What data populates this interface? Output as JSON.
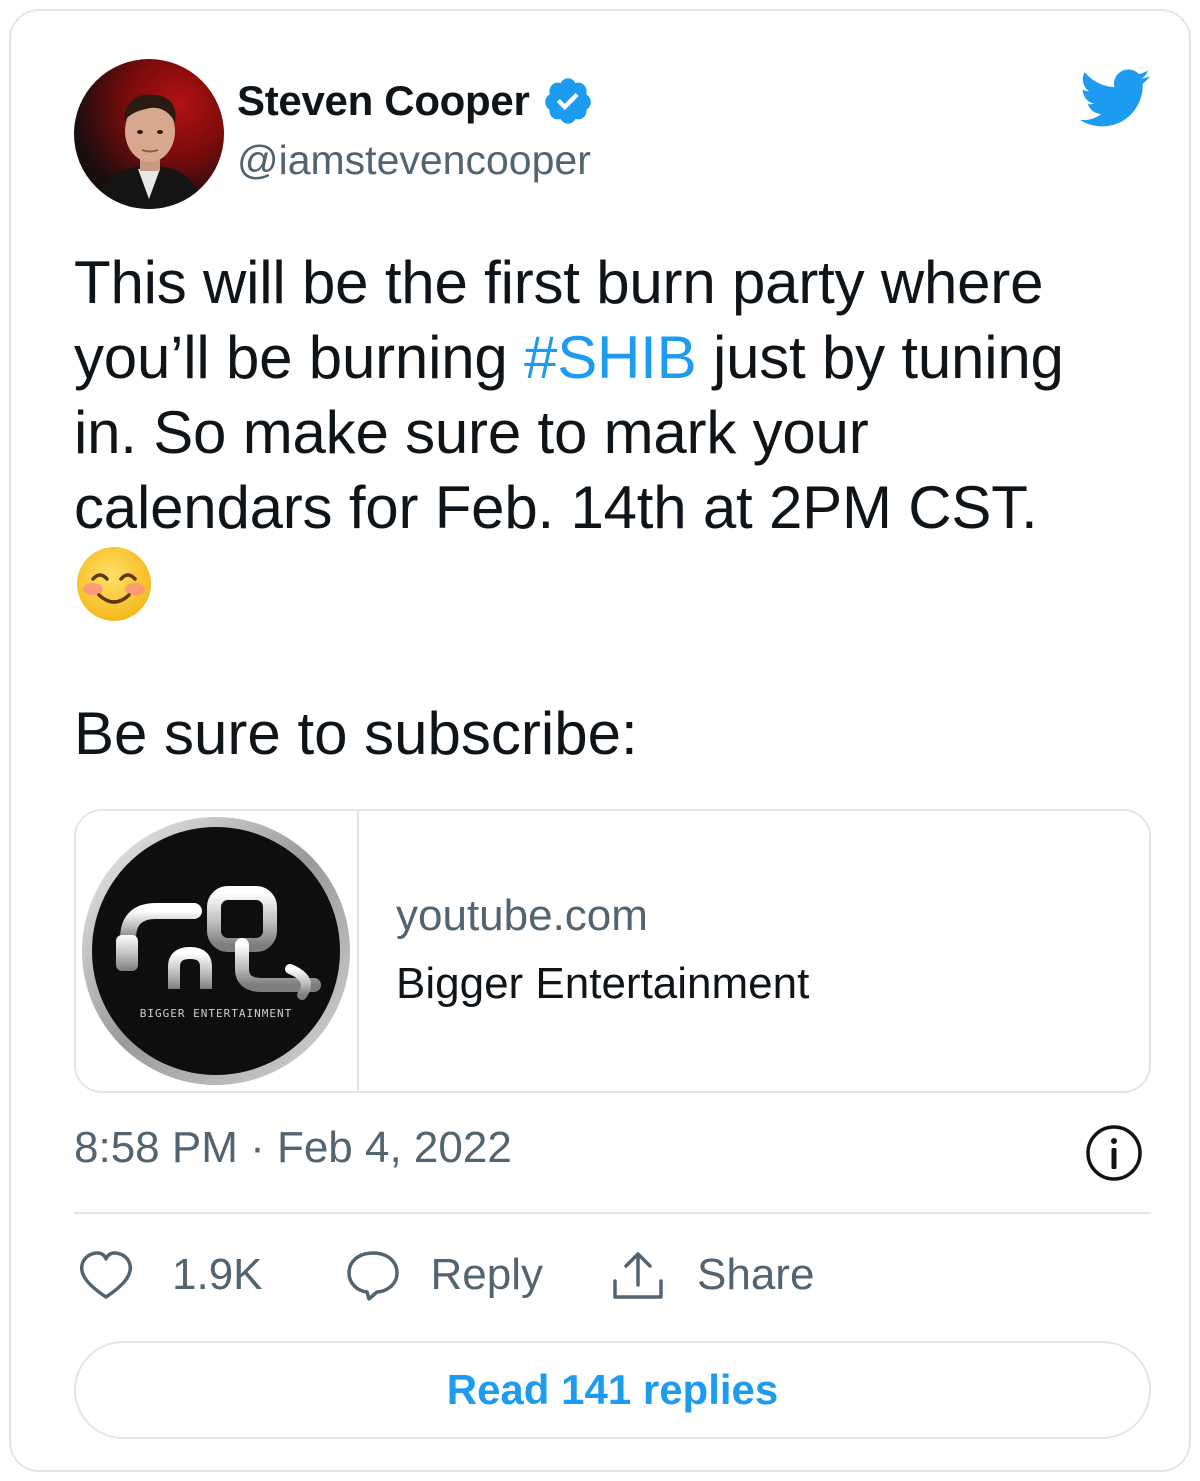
{
  "author": {
    "name": "Steven Cooper",
    "handle": "@iamstevencooper",
    "verified": true
  },
  "tweet": {
    "lines": [
      [
        "This will be the first burn party where"
      ],
      [
        "you’ll be burning ",
        "#SHIB",
        " just by tuning"
      ],
      [
        "in. So make sure to mark your"
      ],
      [
        "calendars for Feb. 14th at 2PM CST."
      ]
    ],
    "line1": "This will be the first burn party where",
    "line2_before": "you’ll be burning ",
    "hashtag": "#SHIB",
    "line2_after": " just by tuning",
    "line3": "in. So make sure to mark your",
    "line4": "calendars for Feb. 14th at 2PM CST.",
    "emoji": "smiling-face-with-smiling-eyes",
    "subscribe_text": "Be sure to subscribe:"
  },
  "link_card": {
    "domain": "youtube.com",
    "title": "Bigger Entertainment",
    "logo_text": "BIGGER ENTERTAINMENT"
  },
  "meta": {
    "timestamp": "8:58 PM · Feb 4, 2022"
  },
  "actions": {
    "likes": "1.9K",
    "reply_label": "Reply",
    "share_label": "Share"
  },
  "read_replies_label": "Read 141 replies",
  "colors": {
    "accent": "#1d9bf0",
    "text": "#0f1419",
    "secondary_text": "#536471",
    "border": "#e3e6e8"
  },
  "icons": [
    "avatar",
    "verified-badge-icon",
    "twitter-bird-icon",
    "smiling-emoji-icon",
    "info-icon",
    "heart-icon",
    "reply-icon",
    "share-icon"
  ]
}
